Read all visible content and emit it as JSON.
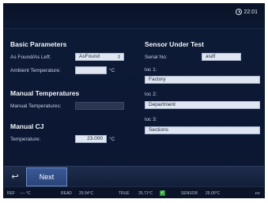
{
  "header": {
    "clock": "22:01"
  },
  "left": {
    "basic_title": "Basic Parameters",
    "as_found_label": "As Found/As Left:",
    "as_found_value": "AsFound",
    "ambient_label": "Ambient Temperature:",
    "ambient_value": "",
    "ambient_unit": "°C",
    "manual_title": "Manual Temperatures",
    "manual_label": "Manual Temperatures:",
    "manual_value": "",
    "cj_title": "Manual CJ",
    "temp_label": "Temperature:",
    "temp_value": "23.000",
    "temp_unit": "°C"
  },
  "right": {
    "sensor_title": "Sensor Under Test",
    "serial_label": "Serial No:",
    "serial_value": "asdf",
    "loc1_label": "loc 1:",
    "loc1_value": "Factory",
    "loc2_label": "loc 2:",
    "loc2_value": "Department",
    "loc3_label": "loc 3:",
    "loc3_value": "Sections"
  },
  "footer": {
    "next_label": "Next"
  },
  "status": {
    "ref_label": "REF",
    "ref_value": "---- °C",
    "read_label": "READ",
    "read_value": "25.54°C",
    "true_label": "TRUE",
    "true_value": "25.71°C",
    "sensor_label": "SENSOR",
    "sensor_value": "25.00°C"
  },
  "icons": {
    "clock": "clock-icon",
    "back": "back-arrow-icon",
    "dropdown": "dropdown-arrow-icon",
    "check": "checkmark-icon",
    "connection": "connection-icon"
  }
}
